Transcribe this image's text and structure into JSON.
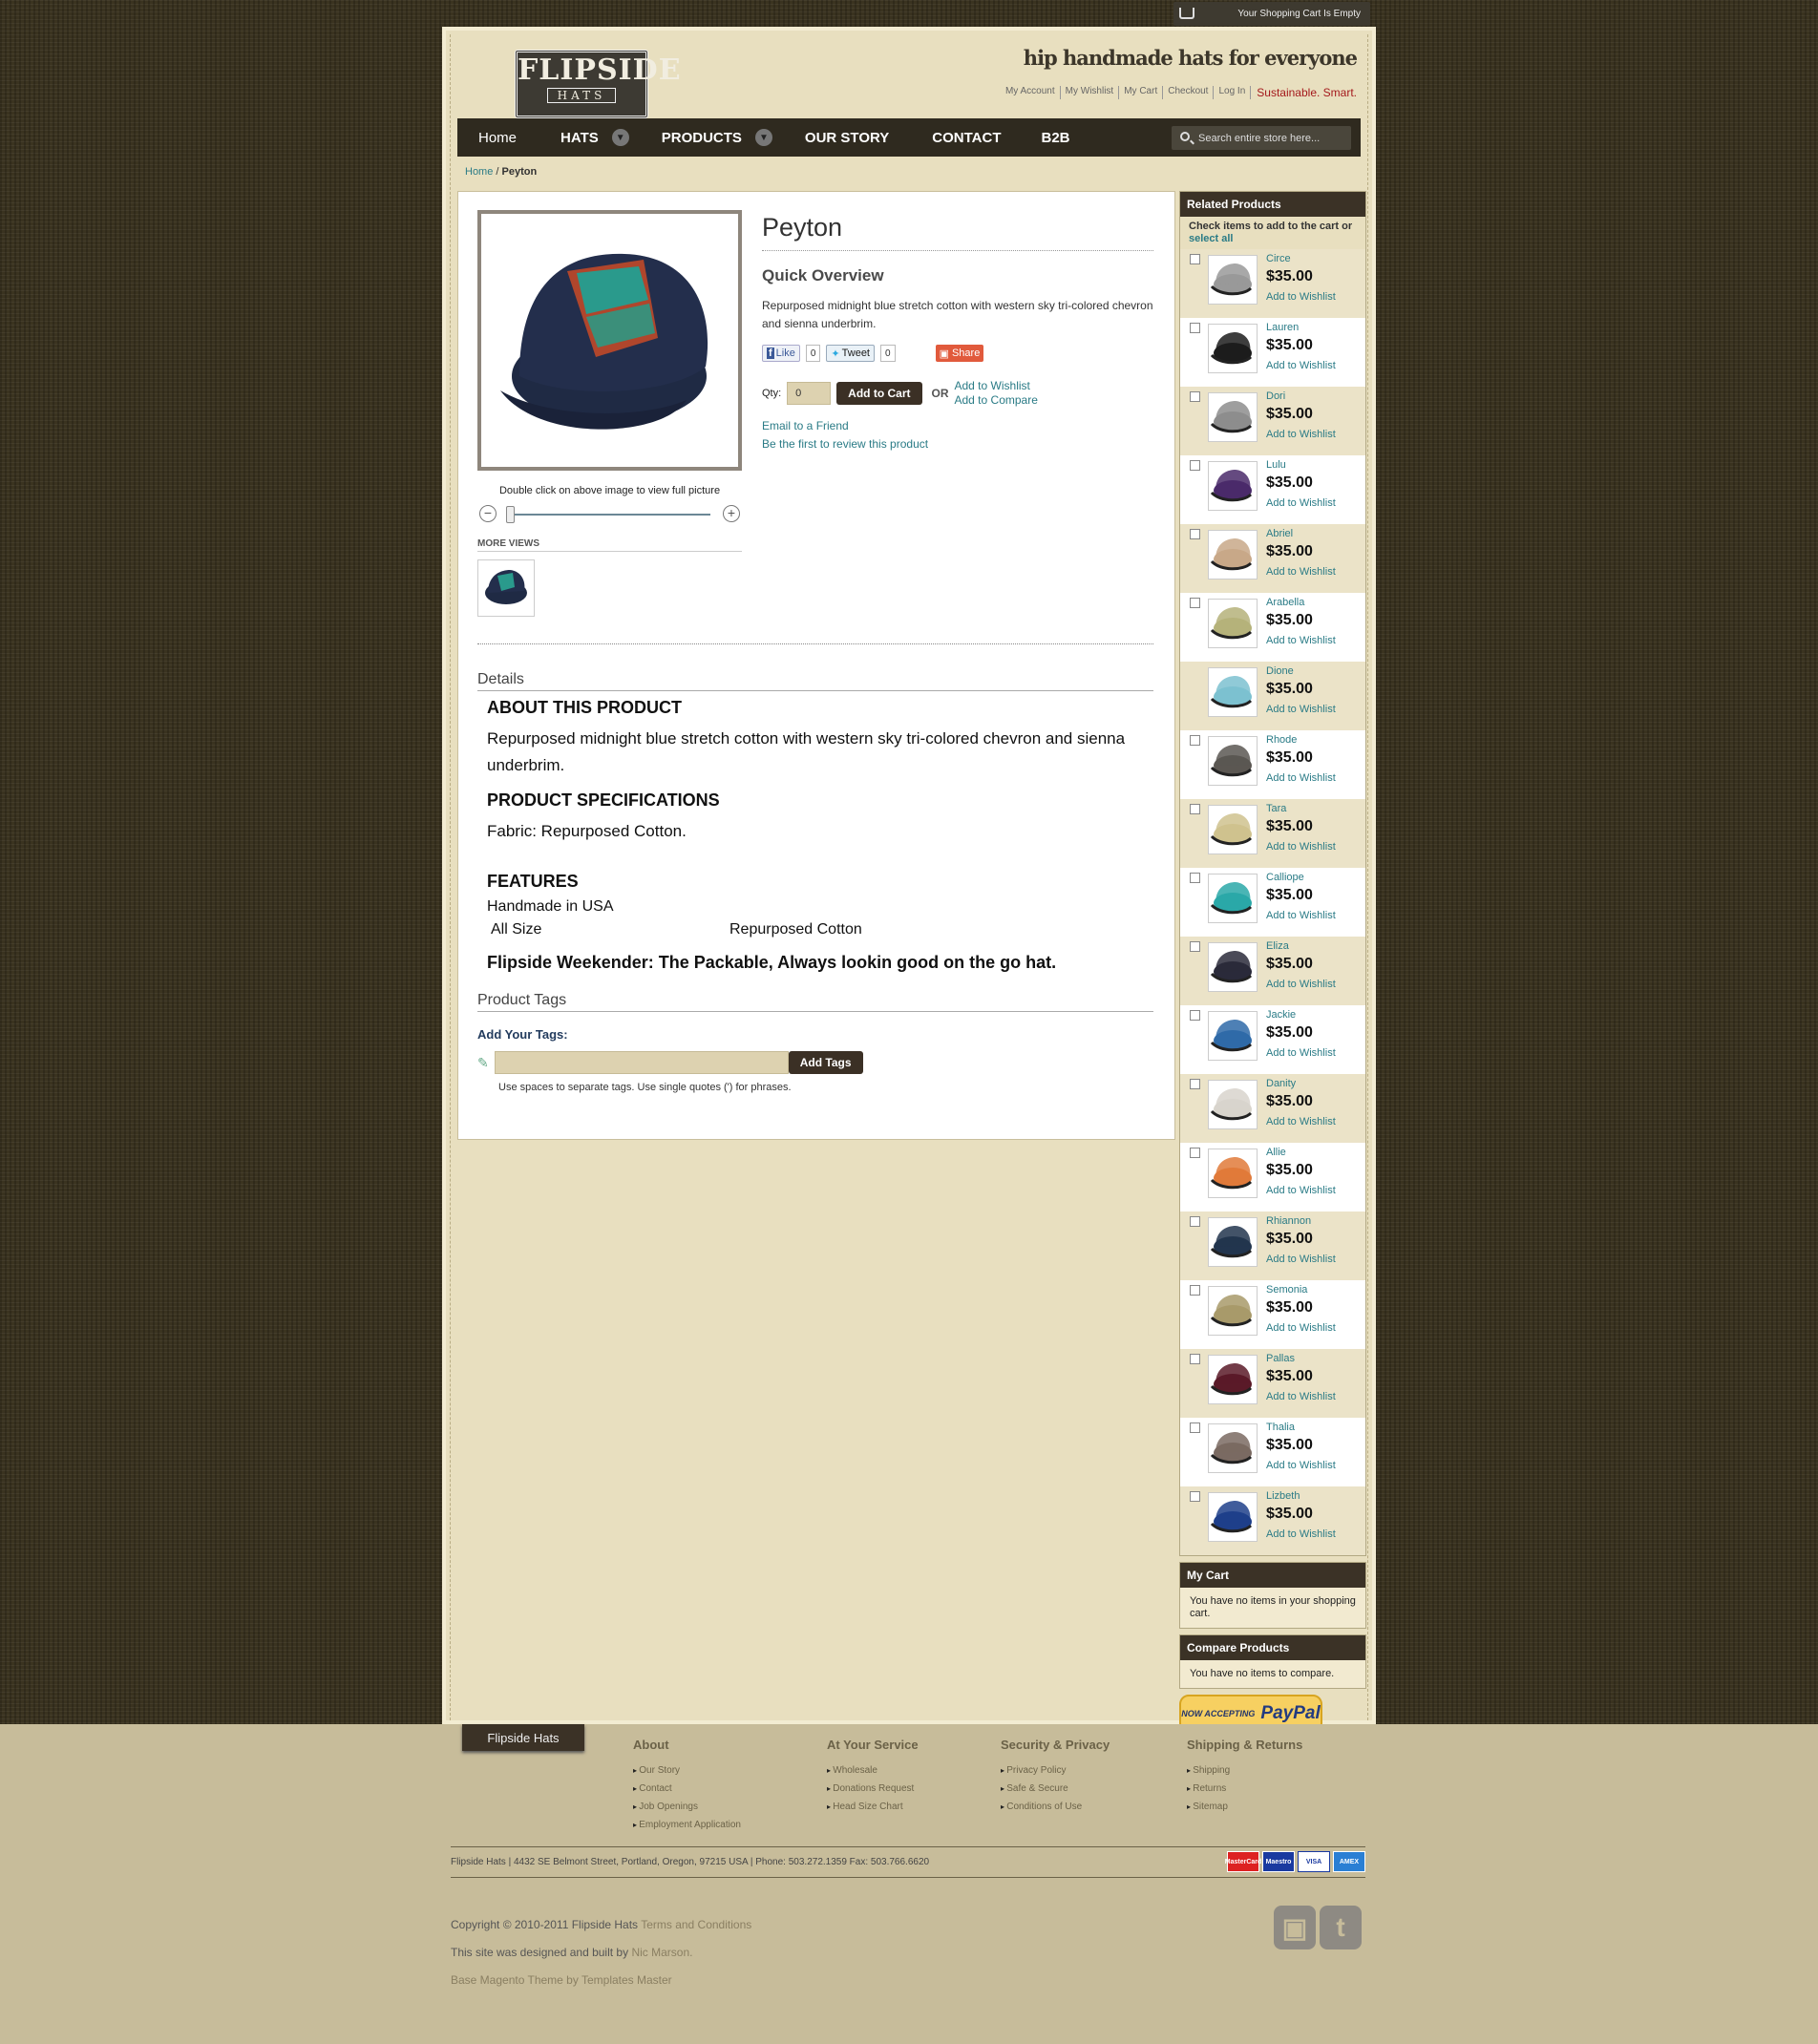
{
  "cart_bar": {
    "text": "Your Shopping Cart Is Empty"
  },
  "header": {
    "logo_top": "FLIPSIDE",
    "logo_bottom": "HATS",
    "tagline": "hip handmade hats for everyone",
    "links": [
      "My Account",
      "My Wishlist",
      "My Cart",
      "Checkout",
      "Log In"
    ],
    "slogan": "Sustainable. Smart."
  },
  "nav": {
    "items": [
      "Home",
      "HATS",
      "PRODUCTS",
      "OUR STORY",
      "CONTACT",
      "B2B"
    ],
    "search_placeholder": "Search entire store here..."
  },
  "breadcrumb": {
    "home": "Home",
    "current": "Peyton"
  },
  "product": {
    "name": "Peyton",
    "quick_overview": "Quick Overview",
    "short_desc": "Repurposed midnight blue stretch cotton with western sky tri-colored chevron and sienna underbrim.",
    "like": "Like",
    "like_count": "0",
    "tweet": "Tweet",
    "tweet_count": "0",
    "share": "Share",
    "qty_label": "Qty:",
    "qty_value": "0",
    "add_to_cart": "Add to Cart",
    "or": "OR",
    "add_wishlist": "Add to Wishlist",
    "add_compare": "Add to Compare",
    "email_friend": "Email to a Friend",
    "review": "Be the first to review this product",
    "zoom_caption": "Double click on above image to view full picture",
    "more_views": "MORE VIEWS"
  },
  "details": {
    "heading": "Details",
    "about_h": "ABOUT THIS PRODUCT",
    "about_p": "Repurposed midnight blue stretch cotton with western sky tri-colored chevron and sienna underbrim.",
    "spec_h": "PRODUCT SPECIFICATIONS",
    "spec_p": "Fabric: Repurposed Cotton.",
    "features_h": "FEATURES",
    "features_1": "Handmade in USA",
    "features_2": "All Size",
    "features_3": "Repurposed Cotton",
    "weekender": "Flipside Weekender: The Packable, Always lookin good on the go hat."
  },
  "tags": {
    "heading": "Product Tags",
    "add_label": "Add Your Tags:",
    "button": "Add Tags",
    "note": "Use spaces to separate tags. Use single quotes (') for phrases."
  },
  "related": {
    "heading": "Related Products",
    "sub1": "Check items to add to the cart or",
    "select_all": "select all",
    "wishlist": "Add to Wishlist",
    "items": [
      {
        "name": "Circe",
        "price": "$35.00",
        "color": "#999999",
        "check": true
      },
      {
        "name": "Lauren",
        "price": "$35.00",
        "color": "#1c1c1c",
        "check": true
      },
      {
        "name": "Dori",
        "price": "$35.00",
        "color": "#8d8d8d",
        "check": true
      },
      {
        "name": "Lulu",
        "price": "$35.00",
        "color": "#4a2a6a",
        "check": true
      },
      {
        "name": "Abriel",
        "price": "$35.00",
        "color": "#c8a888",
        "check": true
      },
      {
        "name": "Arabella",
        "price": "$35.00",
        "color": "#b5b27a",
        "check": true
      },
      {
        "name": "Dione",
        "price": "$35.00",
        "color": "#7cc1d0",
        "check": false
      },
      {
        "name": "Rhode",
        "price": "$35.00",
        "color": "#5b5752",
        "check": true
      },
      {
        "name": "Tara",
        "price": "$35.00",
        "color": "#cfc28e",
        "check": true
      },
      {
        "name": "Calliope",
        "price": "$35.00",
        "color": "#2aa8a8",
        "check": true
      },
      {
        "name": "Eliza",
        "price": "$35.00",
        "color": "#2a2a3a",
        "check": true
      },
      {
        "name": "Jackie",
        "price": "$35.00",
        "color": "#2f6aa8",
        "check": true
      },
      {
        "name": "Danity",
        "price": "$35.00",
        "color": "#d8d4cc",
        "check": true
      },
      {
        "name": "Allie",
        "price": "$35.00",
        "color": "#e07a3a",
        "check": true
      },
      {
        "name": "Rhiannon",
        "price": "$35.00",
        "color": "#22354e",
        "check": true
      },
      {
        "name": "Semonia",
        "price": "$35.00",
        "color": "#a89a6a",
        "check": true
      },
      {
        "name": "Pallas",
        "price": "$35.00",
        "color": "#5a1a28",
        "check": true
      },
      {
        "name": "Thalia",
        "price": "$35.00",
        "color": "#7a6a62",
        "check": true
      },
      {
        "name": "Lizbeth",
        "price": "$35.00",
        "color": "#1e3f8a",
        "check": true
      }
    ]
  },
  "my_cart": {
    "heading": "My Cart",
    "message": "You have no items in your shopping cart."
  },
  "compare": {
    "heading": "Compare Products",
    "message": "You have no items to compare."
  },
  "paypal": {
    "top": "NOW ACCEPTING",
    "brand": "PayPal"
  },
  "footer": {
    "tab": "Flipside Hats",
    "cols": [
      {
        "title": "About",
        "links": [
          "Our Story",
          "Contact",
          "Job Openings",
          "Employment Application"
        ]
      },
      {
        "title": "At Your Service",
        "links": [
          "Wholesale",
          "Donations Request",
          "Head Size Chart"
        ]
      },
      {
        "title": "Security & Privacy",
        "links": [
          "Privacy Policy",
          "Safe & Secure",
          "Conditions of Use"
        ]
      },
      {
        "title": "Shipping & Returns",
        "links": [
          "Shipping",
          "Returns",
          "Sitemap"
        ]
      }
    ],
    "address": "Flipside Hats | 4432 SE Belmont Street, Portland, Oregon, 97215 USA | Phone: 503.272.1359 Fax: 503.766.6620",
    "cards": [
      "MasterCard",
      "Maestro",
      "VISA",
      "AMEX"
    ],
    "copyright": "Copyright © 2010-2011 Flipside Hats",
    "terms": "Terms and Conditions",
    "designed": "This site was designed and built by",
    "designer": "Nic Marson.",
    "theme": "Base Magento Theme by Templates Master"
  }
}
